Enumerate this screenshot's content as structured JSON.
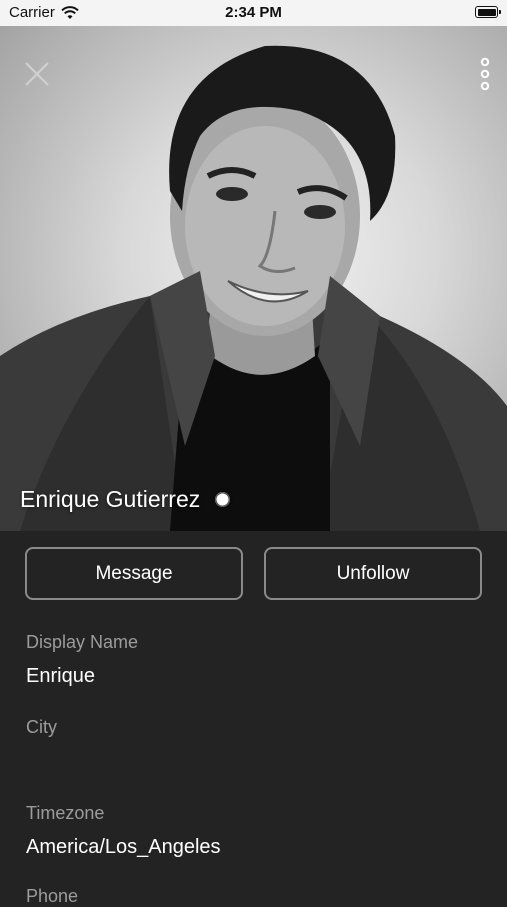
{
  "status_bar": {
    "carrier": "Carrier",
    "time": "2:34 PM"
  },
  "profile": {
    "name": "Enrique Gutierrez",
    "online_status_color": "#ffffff"
  },
  "actions": {
    "message_label": "Message",
    "unfollow_label": "Unfollow"
  },
  "fields": [
    {
      "label": "Display Name",
      "value": "Enrique"
    },
    {
      "label": "City",
      "value": ""
    },
    {
      "label": "Timezone",
      "value": "America/Los_Angeles"
    },
    {
      "label": "Phone",
      "value": ""
    }
  ],
  "icons": {
    "close": "close-icon",
    "more": "more-vertical-icon",
    "wifi": "wifi-icon",
    "battery": "battery-icon"
  },
  "colors": {
    "background": "#232323",
    "label": "#9c9c9c",
    "button_border": "#8a8a8a"
  }
}
